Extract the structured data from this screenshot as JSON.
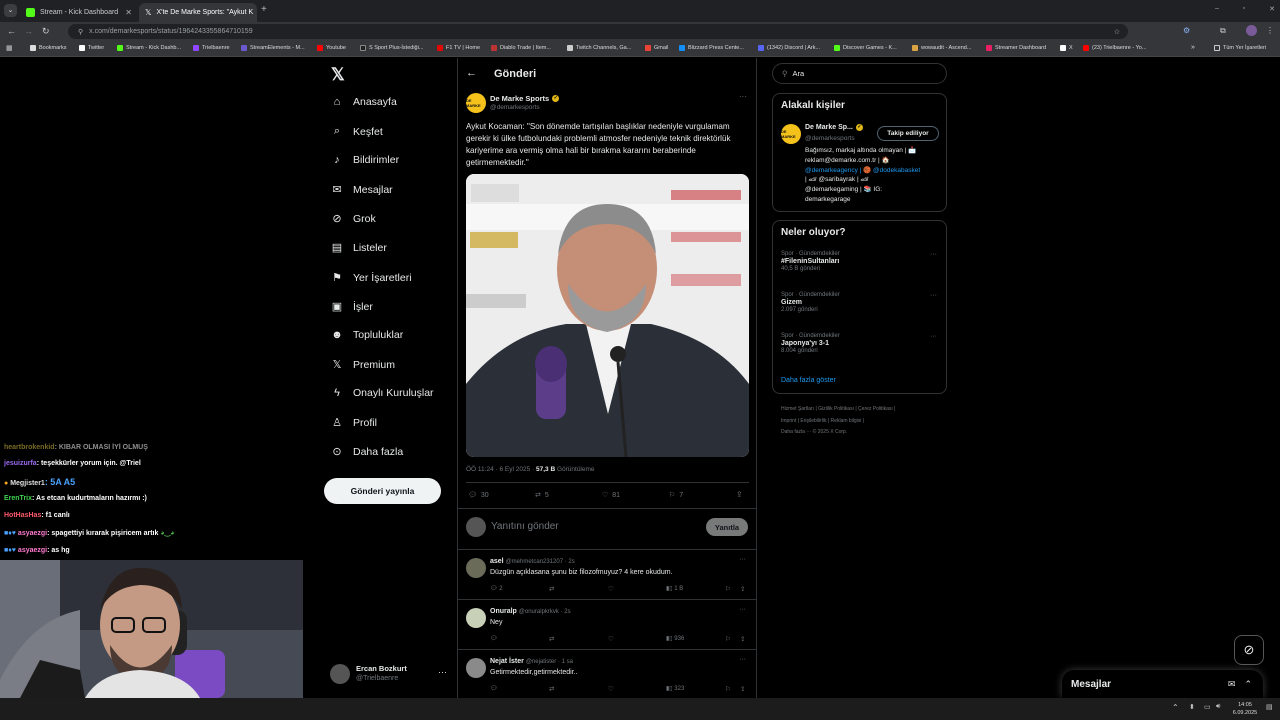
{
  "browser": {
    "tabs": [
      {
        "title": "Stream - Kick Dashboard",
        "color": "#53fc18"
      },
      {
        "title": "X'te De Marke Sports: \"Aykut K",
        "color": "#ffffff"
      }
    ],
    "url": "x.com/demarkesports/status/1964243355864710159",
    "bookmarks": [
      "Bookmarks",
      "Twitter",
      "Stream - Kick Dashb...",
      "Trielbaenre",
      "StreamElements - M...",
      "Youtube",
      "S Sport Plus-İstediği...",
      "F1 TV | Home",
      "Diablo Trade | Item...",
      "Twitch Channels, Ga...",
      "Gmail",
      "Blizzard Press Cente...",
      "(1342) Discord | Ark...",
      "Discover Games - K...",
      "wowaudit - Ascend...",
      "Streamer Dashboard",
      "X",
      "(23) Trielbaenre - Yo..."
    ],
    "bookmarks_all": "Tüm Yer İşaretleri"
  },
  "nav": {
    "items": [
      {
        "label": "Anasayfa",
        "icon": "home-icon",
        "glyph": "⌂"
      },
      {
        "label": "Keşfet",
        "icon": "search-icon",
        "glyph": "⌕"
      },
      {
        "label": "Bildirimler",
        "icon": "bell-icon",
        "glyph": "♪"
      },
      {
        "label": "Mesajlar",
        "icon": "mail-icon",
        "glyph": "✉"
      },
      {
        "label": "Grok",
        "icon": "grok-icon",
        "glyph": "⊘"
      },
      {
        "label": "Listeler",
        "icon": "list-icon",
        "glyph": "▤"
      },
      {
        "label": "Yer İşaretleri",
        "icon": "bookmark-icon",
        "glyph": "⚑"
      },
      {
        "label": "İşler",
        "icon": "briefcase-icon",
        "glyph": "▣"
      },
      {
        "label": "Topluluklar",
        "icon": "people-icon",
        "glyph": "☻"
      },
      {
        "label": "Premium",
        "icon": "x-premium-icon",
        "glyph": "𝕏"
      },
      {
        "label": "Onaylı Kuruluşlar",
        "icon": "lightning-icon",
        "glyph": "ϟ"
      },
      {
        "label": "Profil",
        "icon": "profile-icon",
        "glyph": "♙"
      },
      {
        "label": "Daha fazla",
        "icon": "more-circle-icon",
        "glyph": "⊙"
      }
    ],
    "post_button": "Gönderi yayınla",
    "user_name": "Ercan Bozkurt",
    "user_handle": "@Trielbaenre"
  },
  "post": {
    "header_title": "Gönderi",
    "author_name": "De Marke Sports",
    "author_handle": "@demarkesports",
    "text": "Aykut Kocaman: \"Son dönemde tartışılan başlıklar nedeniyle vurgulamam gerekir ki ülke futbolundaki problemli atmosfer nedeniyle teknik direktörlük kariyerime ara vermiş olma hali bir bırakma kararını beraberinde getirmemektedir.\"",
    "meta_time": "ÖÖ 11:24 · 6 Eyl 2025 · ",
    "views": "57,3 B",
    "views_label": " Görüntüleme",
    "replies": "30",
    "reposts": "5",
    "likes": "81",
    "bookmarks": "7",
    "reply_placeholder": "Yanıtını gönder",
    "reply_button": "Yanıtla"
  },
  "replies": [
    {
      "name": "asel",
      "handle": "@mehmetcan231207 · 2s",
      "text": "Düzgün açıklasana şunu biz filozofmuyuz? 4 kere okudum.",
      "replies": "2",
      "views": "1 B"
    },
    {
      "name": "Onuralp",
      "handle": "@onuralpkrkvk · 2s",
      "text": "Ney",
      "replies": "",
      "views": "936"
    },
    {
      "name": "Nejat İster",
      "handle": "@nejatister · 1 sa",
      "text": "Getirmektedir,getirmektedir..",
      "replies": "",
      "views": "323"
    }
  ],
  "right": {
    "search_placeholder": "Ara",
    "people_title": "Alakalı kişiler",
    "person_name": "De Marke Sp...",
    "person_handle": "@demarkesports",
    "follow_label": "Takip ediliyor",
    "bio_lines": [
      "Bağımsız, markaj altında olmayan | 📩",
      "reklam@demarke.com.tr | 🏠",
      "@demarkeagency | 🏀 @dodekabasket",
      "| 🏎 @saribayrak | 🏎",
      "@demarkegaming | 📚 IG:",
      "demarkegarage"
    ],
    "trends_title": "Neler oluyor?",
    "trends": [
      {
        "category": "Spor · Gündemdekiler",
        "name": "#FileninSultanları",
        "count": "40,5 B gönderi"
      },
      {
        "category": "Spor · Gündemdekiler",
        "name": "Gizem",
        "count": "2.097 gönderi"
      },
      {
        "category": "Spor · Gündemdekiler",
        "name": "Japonya'yı 3-1",
        "count": "8.004 gönderi"
      }
    ],
    "show_more": "Daha fazla göster",
    "footer_lines": [
      "Hizmet Şartları  |  Gizlilik Politikası  |  Çerez Politikası  |",
      "Imprint  |  Erişilebilirlik  |  Reklam bilgisi  |",
      "Daha fazla ···  © 2025 X Corp."
    ],
    "messages_label": "Mesajlar"
  },
  "chat": [
    {
      "user": "heartbrokenkid",
      "text": ": KIBAR OLMASI İYİ OLMUŞ",
      "color": "#d8c040"
    },
    {
      "user": "jesuizurfa",
      "text": ": teşekkürler yorum için. @Triel",
      "color": "#9b6cf2"
    },
    {
      "user": "Megjister1",
      "text": ": 5A A5",
      "color": "#e0e0e0"
    },
    {
      "user": "ErenTrix",
      "text": ": As etcan kudurtmaların hazırmı :)",
      "color": "#3fd24f"
    },
    {
      "user": "HotHasHas",
      "text": ": f1 canlı",
      "color": "#ff5a6a"
    },
    {
      "user": "asyaezgi",
      "text": ": spagettiyi kırarak pişiricem artık",
      "color": "#ff7bd0"
    },
    {
      "user": "asyaezgi",
      "text": ": as hg",
      "color": "#ff7bd0"
    }
  ],
  "taskbar": {
    "time": "14:05",
    "date": "6.09.2025"
  }
}
